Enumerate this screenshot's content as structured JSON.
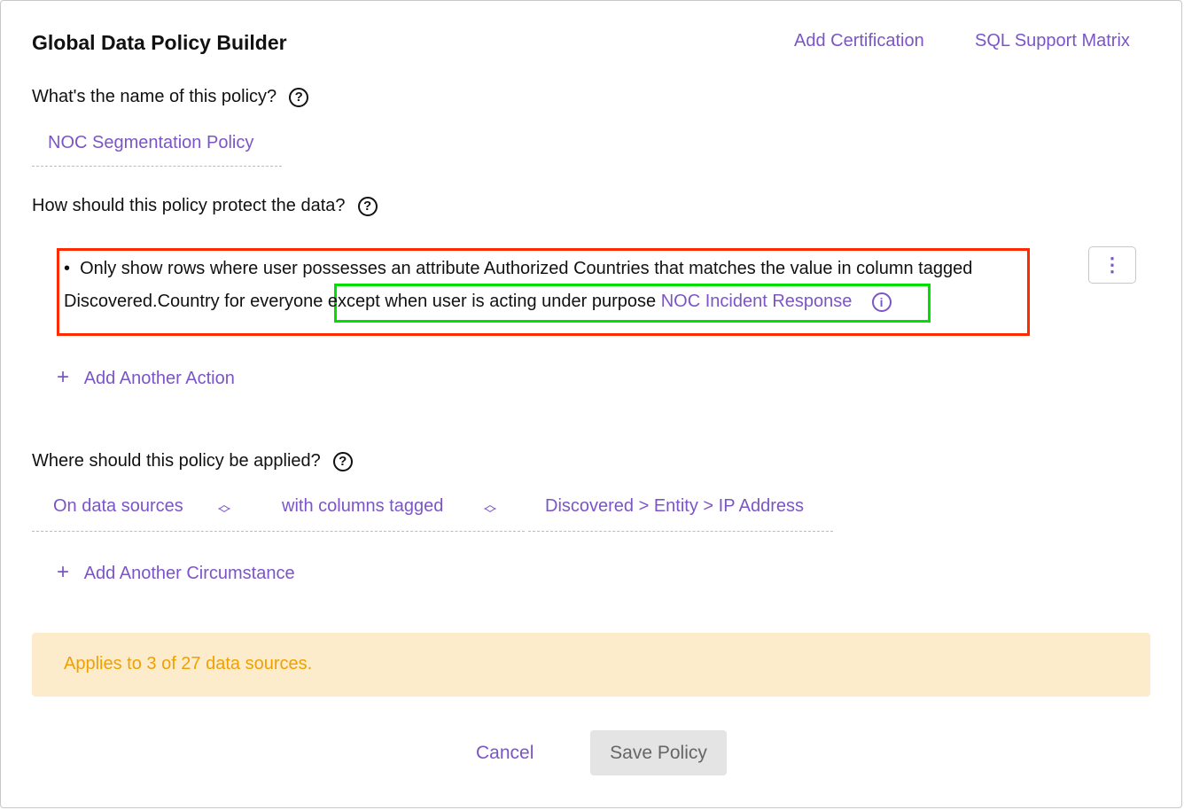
{
  "header": {
    "title": "Global Data Policy Builder",
    "links": [
      "Add Certification",
      "SQL Support Matrix"
    ]
  },
  "name_section": {
    "question": "What's the name of this policy?",
    "value": "NOC Segmentation Policy"
  },
  "protect_section": {
    "question": "How should this policy protect the data?",
    "action_line1": "Only show rows where user possesses an attribute Authorized Countries that matches the value in column tagged",
    "action_line2_prefix": "Discovered.Country for everyone",
    "exception_text": "except when user is acting under purpose",
    "purpose": "NOC Incident Response",
    "add_action": "Add Another Action"
  },
  "apply_section": {
    "question": "Where should this policy be applied?",
    "scope": "On data sources",
    "column_mode": "with columns tagged",
    "tag": "Discovered > Entity > IP Address",
    "add_circumstance": "Add Another Circumstance"
  },
  "banner": "Applies to 3 of 27 data sources.",
  "footer": {
    "cancel": "Cancel",
    "save": "Save Policy"
  }
}
